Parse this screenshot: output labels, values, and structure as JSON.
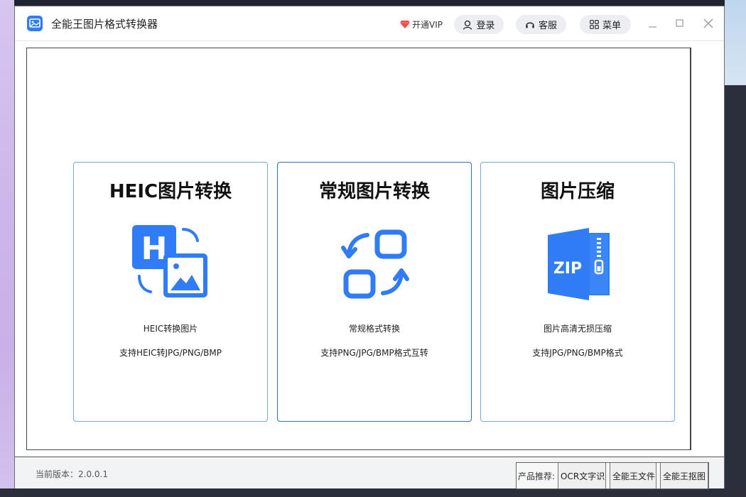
{
  "app": {
    "title": "全能王图片格式转换器",
    "icon": "image-app-icon",
    "accent": "#2f7cf6"
  },
  "header": {
    "vip_label": "开通VIP",
    "login_label": "登录",
    "service_label": "客服",
    "menu_label": "菜单"
  },
  "window_controls": {
    "minimize": "minimize-icon",
    "maximize": "maximize-icon",
    "close": "close-icon"
  },
  "cards": [
    {
      "title": "HEIC图片转换",
      "desc": "HEIC转换图片",
      "sub": "支持HEIC转JPG/PNG/BMP",
      "icon": "heic-convert-icon",
      "active": false
    },
    {
      "title": "常规图片转换",
      "desc": "常规格式转换",
      "sub": "支持PNG/JPG/BMP格式互转",
      "icon": "format-convert-icon",
      "active": true
    },
    {
      "title": "图片压缩",
      "desc": "图片高清无损压缩",
      "sub": "支持JPG/PNG/BMP格式",
      "icon": "zip-compress-icon",
      "zip_text": "ZIP",
      "active": false
    }
  ],
  "status": {
    "version": "当前版本：2.0.0.1",
    "recommend_label": "产品推荐:",
    "recommend_items": [
      "OCR文字识",
      "全能王文件",
      "全能王抠图"
    ]
  },
  "colors": {
    "card_border": "#79a8de",
    "card_border_active": "#2d6fc7",
    "icon_blue": "#2f7cf6"
  }
}
